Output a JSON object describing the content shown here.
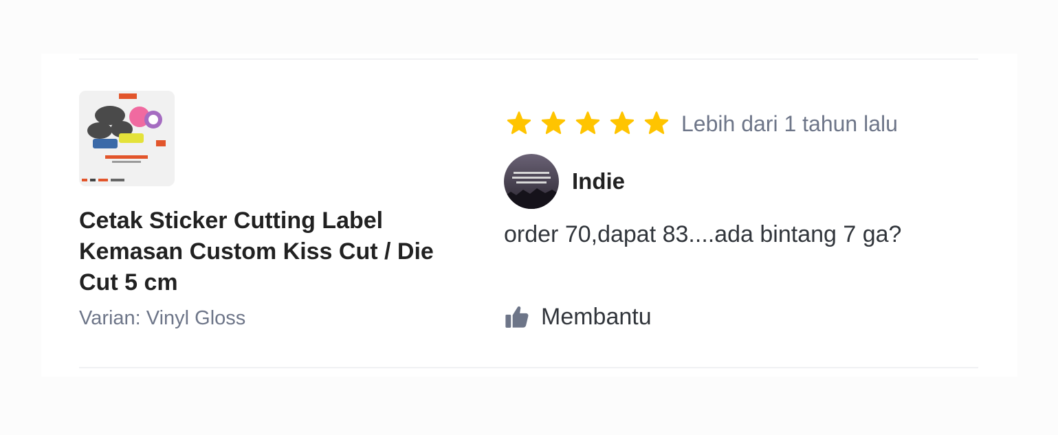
{
  "product": {
    "image_label": "Sticker Die Cut",
    "title": "Cetak Sticker Cutting Label Kemasan Custom Kiss Cut / Die Cut 5 cm",
    "variant": "Varian: Vinyl Gloss"
  },
  "review": {
    "rating": 5,
    "max_rating": 5,
    "star_color": "#ffc400",
    "time": "Lebih dari 1 tahun lalu",
    "reviewer_name": "Indie",
    "text": "order 70,dapat 83....ada bintang 7 ga?",
    "helpful_label": "Membantu",
    "helpful_icon": "thumbs-up-icon"
  }
}
